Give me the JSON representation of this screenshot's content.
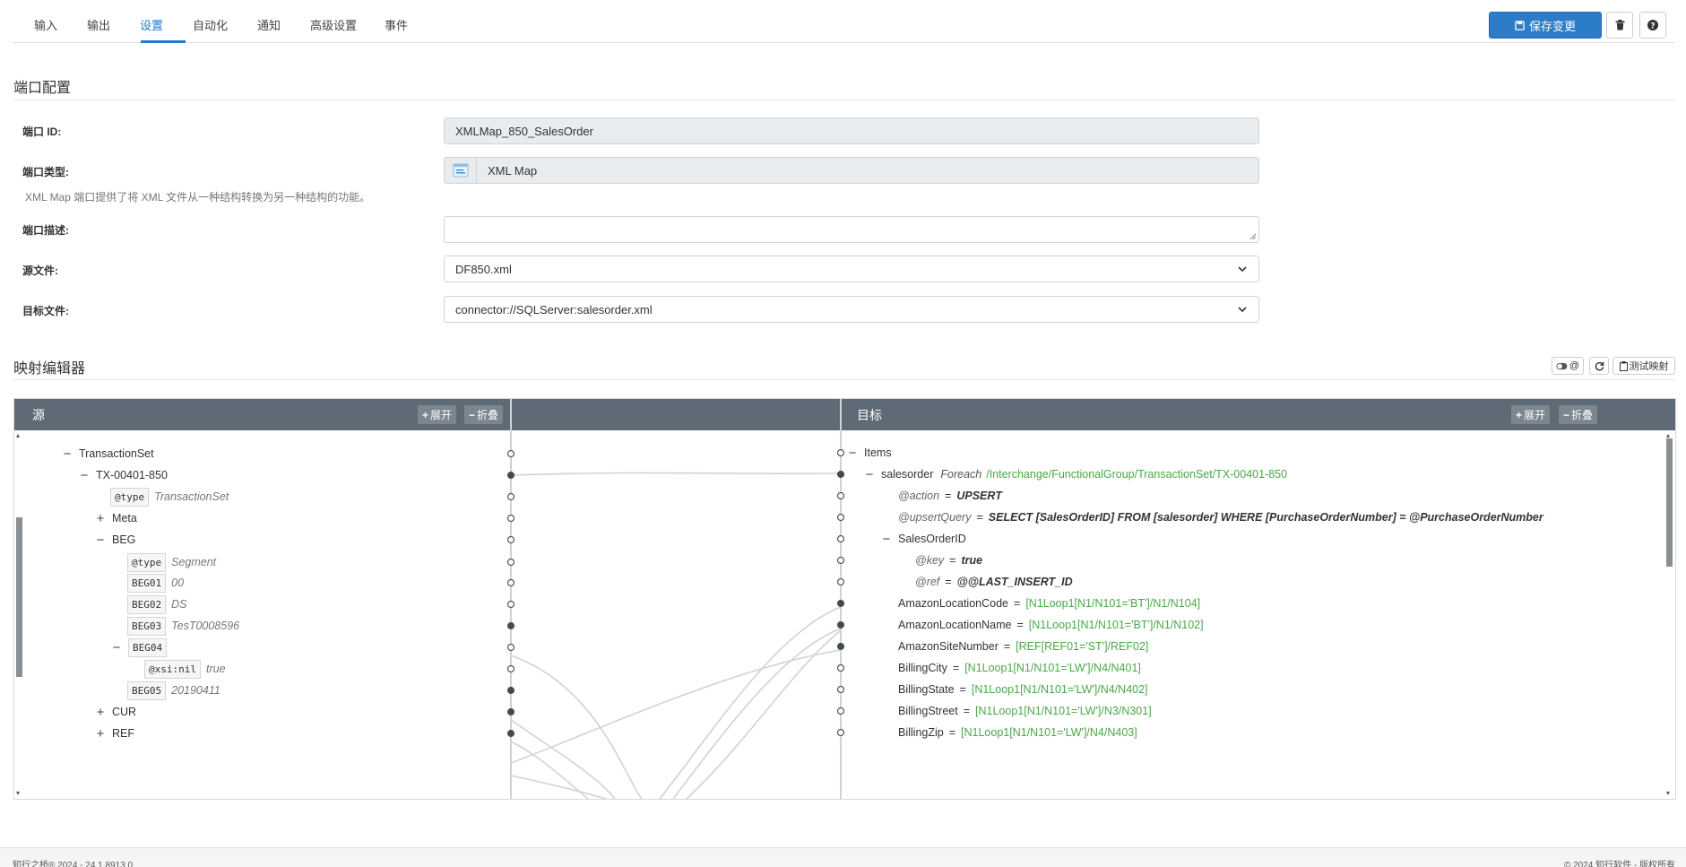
{
  "tabs": [
    {
      "label": "输入",
      "active": false
    },
    {
      "label": "输出",
      "active": false
    },
    {
      "label": "设置",
      "active": true
    },
    {
      "label": "自动化",
      "active": false
    },
    {
      "label": "通知",
      "active": false
    },
    {
      "label": "高级设置",
      "active": false
    },
    {
      "label": "事件",
      "active": false
    }
  ],
  "toolbar": {
    "save_label": "保存变更"
  },
  "port_config": {
    "title": "端口配置",
    "id_label": "端口 ID:",
    "id_value": "XMLMap_850_SalesOrder",
    "type_label": "端口类型:",
    "type_value": "XML Map",
    "type_help": "XML Map 端口提供了将 XML 文件从一种结构转换为另一种结构的功能。",
    "desc_label": "端口描述:",
    "desc_value": "",
    "source_label": "源文件:",
    "source_value": "DF850.xml",
    "target_label": "目标文件:",
    "target_value": "connector://SQLServer:salesorder.xml"
  },
  "mapping_editor": {
    "title": "映射编辑器",
    "toggle_label": "@",
    "test_label": "测试映射",
    "source_header": "源",
    "target_header": "目标",
    "expand_label": "展开",
    "collapse_label": "折叠"
  },
  "source_tree": [
    {
      "toggle": "−",
      "name": "TransactionSet"
    },
    {
      "toggle": "−",
      "name": "TX-00401-850"
    },
    {
      "chip": "@type",
      "value": "TransactionSet"
    },
    {
      "toggle": "+",
      "name": "Meta"
    },
    {
      "toggle": "−",
      "name": "BEG"
    },
    {
      "chip": "@type",
      "value": "Segment"
    },
    {
      "chip": "BEG01",
      "value": "00"
    },
    {
      "chip": "BEG02",
      "value": "DS"
    },
    {
      "chip": "BEG03",
      "value": "TesT0008596"
    },
    {
      "toggle": "−",
      "chip": "BEG04"
    },
    {
      "chip": "@xsi:nil",
      "value": "true"
    },
    {
      "chip": "BEG05",
      "value": "20190411"
    },
    {
      "toggle": "+",
      "name": "CUR"
    },
    {
      "toggle": "+",
      "name": "REF"
    }
  ],
  "target_tree": [
    {
      "toggle": "−",
      "name": "Items"
    },
    {
      "toggle": "−",
      "name": "salesorder",
      "keyword": "Foreach",
      "path": "/Interchange/FunctionalGroup/TransactionSet/TX-00401-850"
    },
    {
      "attr": "@action",
      "eq": "=",
      "value": "UPSERT"
    },
    {
      "attr": "@upsertQuery",
      "eq": "=",
      "value": "SELECT [SalesOrderID] FROM [salesorder] WHERE [PurchaseOrderNumber] = @PurchaseOrderNumber"
    },
    {
      "toggle": "−",
      "name": "SalesOrderID"
    },
    {
      "attr": "@key",
      "eq": "=",
      "value": "true"
    },
    {
      "attr": "@ref",
      "eq": "=",
      "value": "@@LAST_INSERT_ID"
    },
    {
      "name": "AmazonLocationCode",
      "eq": "=",
      "xpath": "[N1Loop1[N1/N101='BT']/N1/N104]"
    },
    {
      "name": "AmazonLocationName",
      "eq": "=",
      "xpath": "[N1Loop1[N1/N101='BT']/N1/N102]"
    },
    {
      "name": "AmazonSiteNumber",
      "eq": "=",
      "xpath": "[REF[REF01='ST']/REF02]"
    },
    {
      "name": "BillingCity",
      "eq": "=",
      "xpath": "[N1Loop1[N1/N101='LW']/N4/N401]"
    },
    {
      "name": "BillingState",
      "eq": "=",
      "xpath": "[N1Loop1[N1/N101='LW']/N4/N402]"
    },
    {
      "name": "BillingStreet",
      "eq": "=",
      "xpath": "[N1Loop1[N1/N101='LW']/N3/N301]"
    },
    {
      "name": "BillingZip",
      "eq": "=",
      "xpath": "[N1Loop1[N1/N101='LW']/N4/N403]"
    }
  ],
  "footer": {
    "left": "知行之桥® 2024 - 24.1.8913.0",
    "right": "© 2024 知行软件 - 版权所有"
  },
  "colors": {
    "accent": "#1f7ad0",
    "header_bg": "#5e6a75",
    "xpath_green": "#4aa84a"
  }
}
